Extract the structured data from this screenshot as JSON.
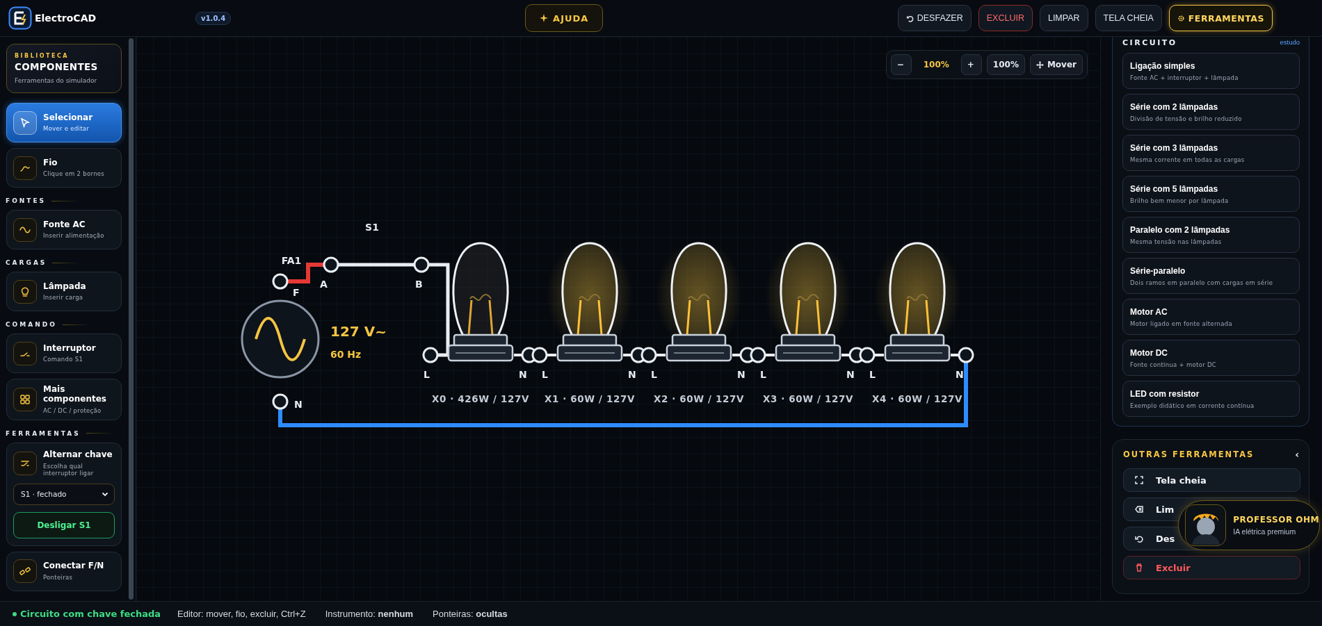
{
  "app": {
    "name": "ElectroCAD",
    "version": "v1.0.4",
    "help": "AJUDA"
  },
  "toolbar": [
    {
      "label": "DESFAZER",
      "kind": "undo"
    },
    {
      "label": "EXCLUIR",
      "kind": "danger"
    },
    {
      "label": "LIMPAR",
      "kind": "plain"
    },
    {
      "label": "TELA CHEIA",
      "kind": "plain"
    },
    {
      "label": "FERRAMENTAS",
      "kind": "accent"
    }
  ],
  "sidebar": {
    "library": {
      "eyebrow": "BIBLIOTECA",
      "title": "COMPONENTES",
      "subtitle": "Ferramentas do simulador"
    },
    "entries": [
      {
        "kind": "tool",
        "title": "Selecionar",
        "subtitle": "Mover e editar",
        "selected": true
      },
      {
        "kind": "tool",
        "title": "Fio",
        "subtitle": "Clique em 2 bornes",
        "selected": false
      },
      {
        "kind": "heading",
        "title": "FONTES"
      },
      {
        "kind": "tool",
        "title": "Fonte AC",
        "subtitle": "Inserir alimentação",
        "selected": false
      },
      {
        "kind": "heading",
        "title": "CARGAS"
      },
      {
        "kind": "tool",
        "title": "Lâmpada",
        "subtitle": "Inserir carga",
        "selected": false
      },
      {
        "kind": "heading",
        "title": "COMANDO"
      },
      {
        "kind": "tool",
        "title": "Interruptor",
        "subtitle": "Comando S1",
        "selected": false
      },
      {
        "kind": "tool",
        "title": "Mais componentes",
        "subtitle": "AC / DC / proteção",
        "selected": false
      },
      {
        "kind": "heading",
        "title": "FERRAMENTAS"
      },
      {
        "kind": "switcher",
        "title": "Alternar chave",
        "subtitle": "Escolha qual interruptor ligar",
        "select_value": "S1 · fechado",
        "button": "Desligar S1"
      },
      {
        "kind": "tool",
        "title": "Conectar F/N",
        "subtitle": "Ponteiras",
        "selected": false
      }
    ]
  },
  "canvas": {
    "zoom": {
      "zoom_out": "−",
      "value": "100%",
      "zoom_in": "+",
      "reset": "100%",
      "move": "Mover"
    },
    "source": {
      "name": "FA1",
      "voltage": "127 V~",
      "frequency": "60 Hz",
      "terminal_top": "F",
      "terminal_bottom": "N"
    },
    "switch": {
      "name": "S1",
      "terminal_a": "A",
      "terminal_b": "B",
      "closed": true
    },
    "lamps": [
      {
        "label": "X0 · 426W / 127V",
        "terminal_left": "L",
        "terminal_right": "N",
        "lit": false
      },
      {
        "label": "X1 · 60W / 127V",
        "terminal_left": "L",
        "terminal_right": "N",
        "lit": true
      },
      {
        "label": "X2 · 60W / 127V",
        "terminal_left": "L",
        "terminal_right": "N",
        "lit": true
      },
      {
        "label": "X3 · 60W / 127V",
        "terminal_left": "L",
        "terminal_right": "N",
        "lit": true
      },
      {
        "label": "X4 · 60W / 127V",
        "terminal_left": "L",
        "terminal_right": "N",
        "lit": true
      }
    ]
  },
  "right_panel": {
    "title": "CIRCUITO",
    "link": "estudo",
    "circuits": [
      {
        "title": "Ligação simples",
        "subtitle": "Fonte AC + interruptor + lâmpada"
      },
      {
        "title": "Série com 2 lâmpadas",
        "subtitle": "Divisão de tensão e brilho reduzido"
      },
      {
        "title": "Série com 3 lâmpadas",
        "subtitle": "Mesma corrente em todas as cargas"
      },
      {
        "title": "Série com 5 lâmpadas",
        "subtitle": "Brilho bem menor por lâmpada"
      },
      {
        "title": "Paralelo com 2 lâmpadas",
        "subtitle": "Mesma tensão nas lâmpadas"
      },
      {
        "title": "Série-paralelo",
        "subtitle": "Dois ramos em paralelo com cargas em série"
      },
      {
        "title": "Motor AC",
        "subtitle": "Motor ligado em fonte alternada"
      },
      {
        "title": "Motor DC",
        "subtitle": "Fonte contínua + motor DC"
      },
      {
        "title": "LED com resistor",
        "subtitle": "Exemplo didático em corrente contínua"
      }
    ],
    "other_tools": {
      "title": "OUTRAS FERRAMENTAS",
      "collapse": "‹",
      "items": [
        {
          "label": "Tela cheia",
          "kind": "normal"
        },
        {
          "label": "Lim",
          "kind": "normal"
        },
        {
          "label": "Des",
          "kind": "normal"
        },
        {
          "label": "Excluir",
          "kind": "danger"
        }
      ]
    }
  },
  "assistant": {
    "name": "PROFESSOR OHM",
    "subtitle": "IA elétrica premium"
  },
  "status_bar": {
    "state": "Circuito com chave fechada",
    "ok": true,
    "items": [
      "Editor: mover, fio, excluir, Ctrl+Z",
      "Instrumento: **nenhum**",
      "Ponteiras: **ocultas**"
    ]
  }
}
